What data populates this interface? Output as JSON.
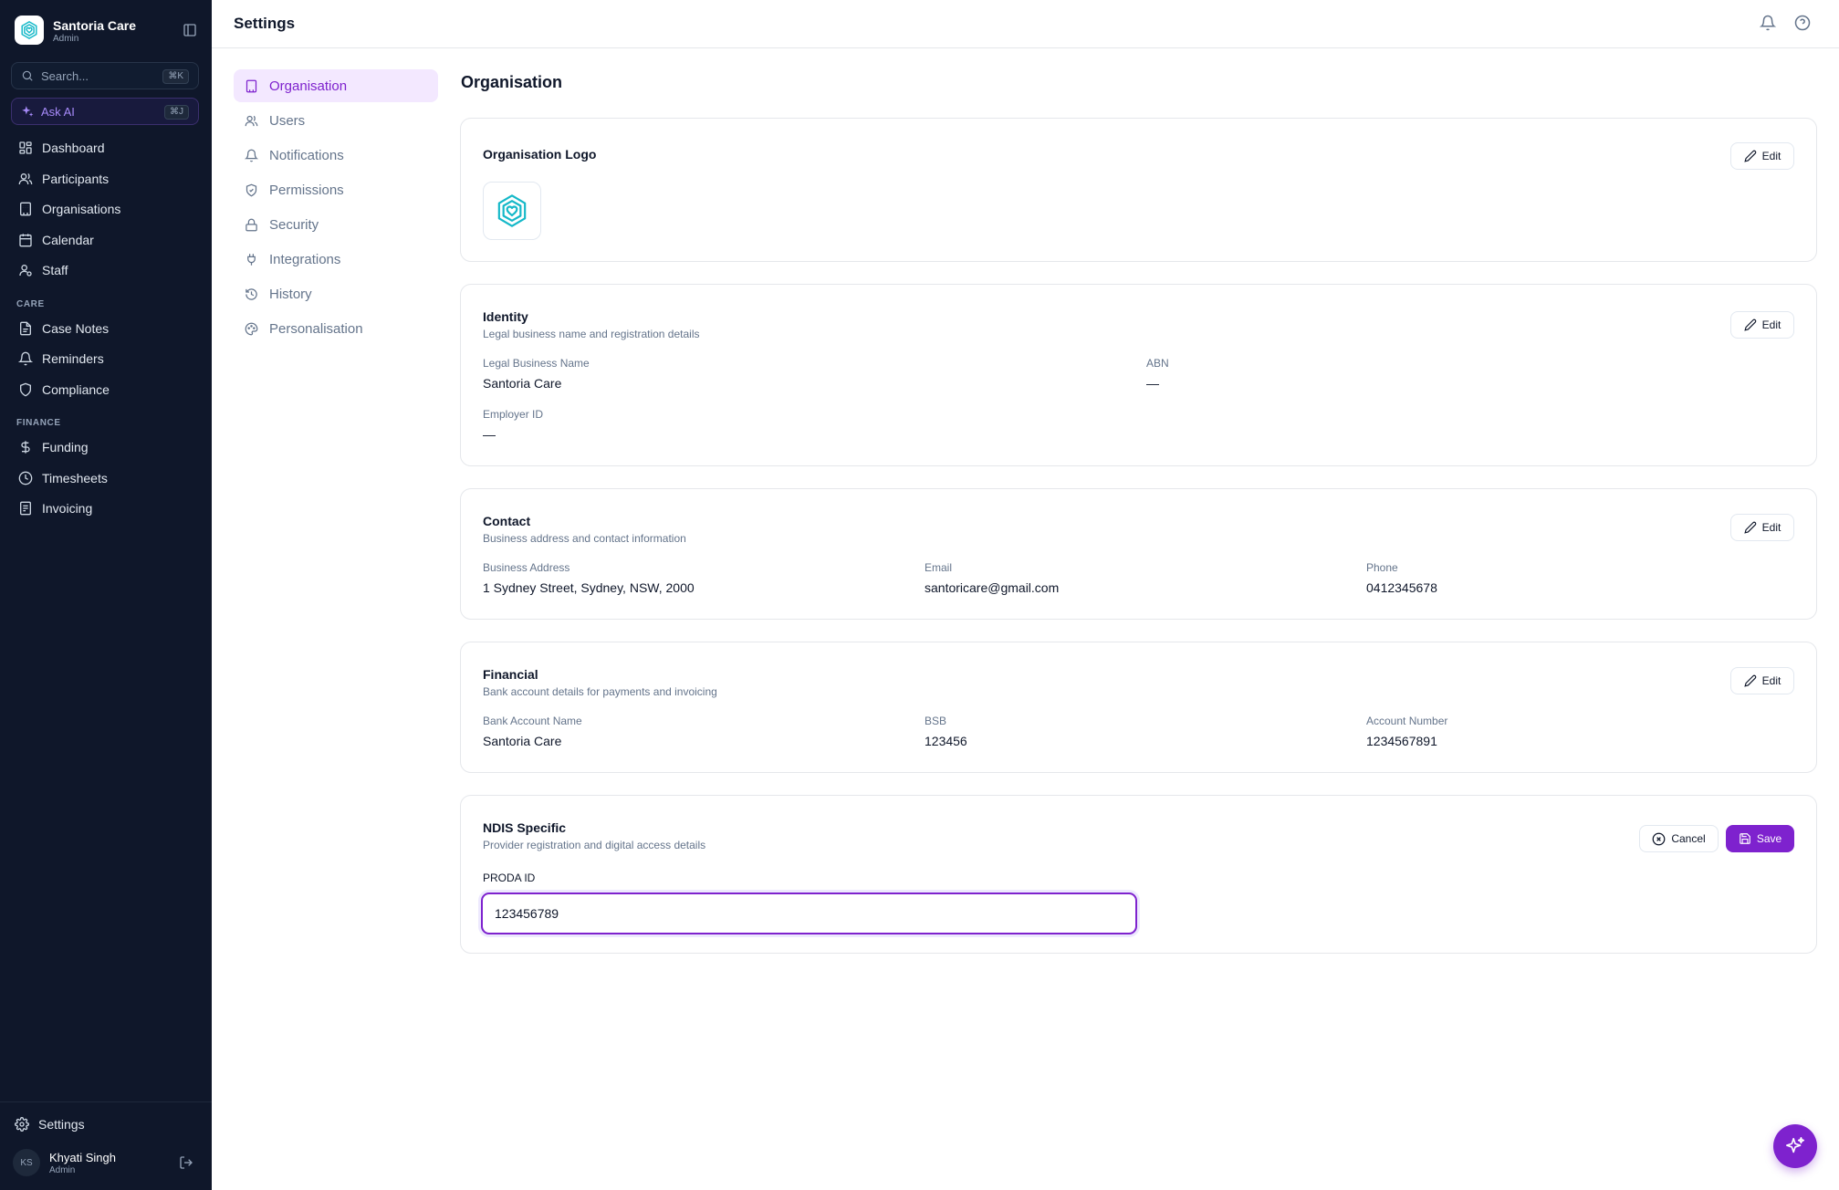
{
  "app": {
    "name": "Santoria Care",
    "role": "Admin"
  },
  "sidebar": {
    "search_placeholder": "Search...",
    "search_shortcut": "⌘K",
    "ask_ai_label": "Ask AI",
    "ask_ai_shortcut": "⌘J",
    "main_items": [
      {
        "label": "Dashboard",
        "icon": "dashboard-icon"
      },
      {
        "label": "Participants",
        "icon": "users-icon"
      },
      {
        "label": "Organisations",
        "icon": "building-icon"
      },
      {
        "label": "Calendar",
        "icon": "calendar-icon"
      },
      {
        "label": "Staff",
        "icon": "staff-icon"
      }
    ],
    "care_section_label": "CARE",
    "care_items": [
      {
        "label": "Case Notes",
        "icon": "notes-icon"
      },
      {
        "label": "Reminders",
        "icon": "bell-icon"
      },
      {
        "label": "Compliance",
        "icon": "shield-icon"
      }
    ],
    "finance_section_label": "FINANCE",
    "finance_items": [
      {
        "label": "Funding",
        "icon": "dollar-icon"
      },
      {
        "label": "Timesheets",
        "icon": "clock-icon"
      },
      {
        "label": "Invoicing",
        "icon": "invoice-icon"
      }
    ],
    "settings_label": "Settings",
    "user": {
      "initials": "KS",
      "name": "Khyati Singh",
      "role": "Admin"
    }
  },
  "header": {
    "title": "Settings"
  },
  "settings_nav": [
    {
      "label": "Organisation",
      "icon": "building-icon",
      "active": true
    },
    {
      "label": "Users",
      "icon": "users-icon",
      "active": false
    },
    {
      "label": "Notifications",
      "icon": "bell-icon",
      "active": false
    },
    {
      "label": "Permissions",
      "icon": "shield-check-icon",
      "active": false
    },
    {
      "label": "Security",
      "icon": "lock-icon",
      "active": false
    },
    {
      "label": "Integrations",
      "icon": "plug-icon",
      "active": false
    },
    {
      "label": "History",
      "icon": "history-icon",
      "active": false
    },
    {
      "label": "Personalisation",
      "icon": "palette-icon",
      "active": false
    }
  ],
  "main": {
    "title": "Organisation",
    "edit_label": "Edit",
    "logo_card": {
      "title": "Organisation Logo"
    },
    "identity": {
      "title": "Identity",
      "subtitle": "Legal business name and registration details",
      "legal_name_label": "Legal Business Name",
      "legal_name_value": "Santoria Care",
      "abn_label": "ABN",
      "abn_value": "—",
      "employer_id_label": "Employer ID",
      "employer_id_value": "—"
    },
    "contact": {
      "title": "Contact",
      "subtitle": "Business address and contact information",
      "address_label": "Business Address",
      "address_value": "1 Sydney Street, Sydney, NSW, 2000",
      "email_label": "Email",
      "email_value": "santoricare@gmail.com",
      "phone_label": "Phone",
      "phone_value": "0412345678"
    },
    "financial": {
      "title": "Financial",
      "subtitle": "Bank account details for payments and invoicing",
      "account_name_label": "Bank Account Name",
      "account_name_value": "Santoria Care",
      "bsb_label": "BSB",
      "bsb_value": "123456",
      "account_number_label": "Account Number",
      "account_number_value": "1234567891"
    },
    "ndis": {
      "title": "NDIS Specific",
      "subtitle": "Provider registration and digital access details",
      "cancel_label": "Cancel",
      "save_label": "Save",
      "proda_label": "PRODA ID",
      "proda_value": "123456789"
    }
  },
  "colors": {
    "sidebar_bg": "#0f172a",
    "accent": "#7e22ce",
    "accent_light": "#f3e8ff",
    "logo_teal": "#14b8c8"
  }
}
